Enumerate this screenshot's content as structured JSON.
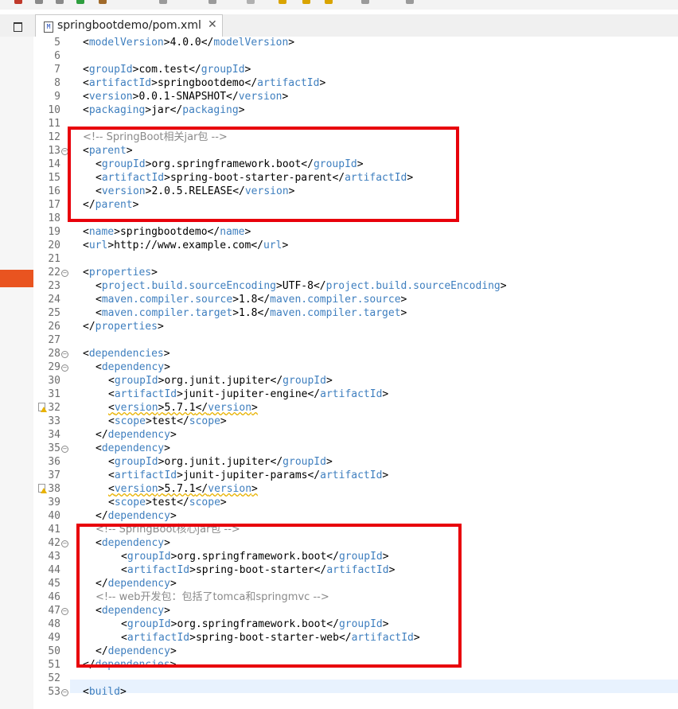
{
  "editor_tab": {
    "title": "springbootdemo/pom.xml",
    "close": "✕",
    "file_icon": "M"
  },
  "highlight_color": "#e8000b",
  "lines": [
    {
      "n": "5",
      "indent": 0,
      "tokens": [
        [
          "b",
          "<"
        ],
        [
          "t",
          "modelVersion"
        ],
        [
          "b",
          ">"
        ],
        [
          "x",
          "4.0.0"
        ],
        [
          "b",
          "</"
        ],
        [
          "t",
          "modelVersion"
        ],
        [
          "b",
          ">"
        ]
      ]
    },
    {
      "n": "6",
      "indent": 0,
      "tokens": []
    },
    {
      "n": "7",
      "indent": 0,
      "tokens": [
        [
          "b",
          "<"
        ],
        [
          "t",
          "groupId"
        ],
        [
          "b",
          ">"
        ],
        [
          "x",
          "com.test"
        ],
        [
          "b",
          "</"
        ],
        [
          "t",
          "groupId"
        ],
        [
          "b",
          ">"
        ]
      ]
    },
    {
      "n": "8",
      "indent": 0,
      "tokens": [
        [
          "b",
          "<"
        ],
        [
          "t",
          "artifactId"
        ],
        [
          "b",
          ">"
        ],
        [
          "x",
          "springbootdemo"
        ],
        [
          "b",
          "</"
        ],
        [
          "t",
          "artifactId"
        ],
        [
          "b",
          ">"
        ]
      ]
    },
    {
      "n": "9",
      "indent": 0,
      "tokens": [
        [
          "b",
          "<"
        ],
        [
          "t",
          "version"
        ],
        [
          "b",
          ">"
        ],
        [
          "x",
          "0.0.1-SNAPSHOT"
        ],
        [
          "b",
          "</"
        ],
        [
          "t",
          "version"
        ],
        [
          "b",
          ">"
        ]
      ]
    },
    {
      "n": "10",
      "indent": 0,
      "tokens": [
        [
          "b",
          "<"
        ],
        [
          "t",
          "packaging"
        ],
        [
          "b",
          ">"
        ],
        [
          "x",
          "jar"
        ],
        [
          "b",
          "</"
        ],
        [
          "t",
          "packaging"
        ],
        [
          "b",
          ">"
        ]
      ]
    },
    {
      "n": "11",
      "indent": 0,
      "tokens": []
    },
    {
      "n": "12",
      "indent": 0,
      "tokens": [
        [
          "c",
          "<!-- SpringBoot相关jar包 -->"
        ]
      ]
    },
    {
      "n": "13",
      "indent": 0,
      "fold": true,
      "tokens": [
        [
          "b",
          "<"
        ],
        [
          "t",
          "parent"
        ],
        [
          "b",
          ">"
        ]
      ]
    },
    {
      "n": "14",
      "indent": 1,
      "tokens": [
        [
          "b",
          "<"
        ],
        [
          "t",
          "groupId"
        ],
        [
          "b",
          ">"
        ],
        [
          "x",
          "org.springframework.boot"
        ],
        [
          "b",
          "</"
        ],
        [
          "t",
          "groupId"
        ],
        [
          "b",
          ">"
        ]
      ]
    },
    {
      "n": "15",
      "indent": 1,
      "tokens": [
        [
          "b",
          "<"
        ],
        [
          "t",
          "artifactId"
        ],
        [
          "b",
          ">"
        ],
        [
          "x",
          "spring-boot-starter-parent"
        ],
        [
          "b",
          "</"
        ],
        [
          "t",
          "artifactId"
        ],
        [
          "b",
          ">"
        ]
      ]
    },
    {
      "n": "16",
      "indent": 1,
      "tokens": [
        [
          "b",
          "<"
        ],
        [
          "t",
          "version"
        ],
        [
          "b",
          ">"
        ],
        [
          "x",
          "2.0.5.RELEASE"
        ],
        [
          "b",
          "</"
        ],
        [
          "t",
          "version"
        ],
        [
          "b",
          ">"
        ]
      ]
    },
    {
      "n": "17",
      "indent": 0,
      "tokens": [
        [
          "b",
          "</"
        ],
        [
          "t",
          "parent"
        ],
        [
          "b",
          ">"
        ]
      ]
    },
    {
      "n": "18",
      "indent": 0,
      "tokens": []
    },
    {
      "n": "19",
      "indent": 0,
      "tokens": [
        [
          "b",
          "<"
        ],
        [
          "t",
          "name"
        ],
        [
          "b",
          ">"
        ],
        [
          "x",
          "springbootdemo"
        ],
        [
          "b",
          "</"
        ],
        [
          "t",
          "name"
        ],
        [
          "b",
          ">"
        ]
      ]
    },
    {
      "n": "20",
      "indent": 0,
      "tokens": [
        [
          "b",
          "<"
        ],
        [
          "t",
          "url"
        ],
        [
          "b",
          ">"
        ],
        [
          "x",
          "http://www.example.com"
        ],
        [
          "b",
          "</"
        ],
        [
          "t",
          "url"
        ],
        [
          "b",
          ">"
        ]
      ]
    },
    {
      "n": "21",
      "indent": 0,
      "tokens": []
    },
    {
      "n": "22",
      "indent": 0,
      "fold": true,
      "tokens": [
        [
          "b",
          "<"
        ],
        [
          "t",
          "properties"
        ],
        [
          "b",
          ">"
        ]
      ]
    },
    {
      "n": "23",
      "indent": 1,
      "tokens": [
        [
          "b",
          "<"
        ],
        [
          "t",
          "project.build.sourceEncoding"
        ],
        [
          "b",
          ">"
        ],
        [
          "x",
          "UTF-8"
        ],
        [
          "b",
          "</"
        ],
        [
          "t",
          "project.build.sourceEncoding"
        ],
        [
          "b",
          ">"
        ]
      ]
    },
    {
      "n": "24",
      "indent": 1,
      "tokens": [
        [
          "b",
          "<"
        ],
        [
          "t",
          "maven.compiler.source"
        ],
        [
          "b",
          ">"
        ],
        [
          "x",
          "1.8"
        ],
        [
          "b",
          "</"
        ],
        [
          "t",
          "maven.compiler.source"
        ],
        [
          "b",
          ">"
        ]
      ]
    },
    {
      "n": "25",
      "indent": 1,
      "tokens": [
        [
          "b",
          "<"
        ],
        [
          "t",
          "maven.compiler.target"
        ],
        [
          "b",
          ">"
        ],
        [
          "x",
          "1.8"
        ],
        [
          "b",
          "</"
        ],
        [
          "t",
          "maven.compiler.target"
        ],
        [
          "b",
          ">"
        ]
      ]
    },
    {
      "n": "26",
      "indent": 0,
      "tokens": [
        [
          "b",
          "</"
        ],
        [
          "t",
          "properties"
        ],
        [
          "b",
          ">"
        ]
      ]
    },
    {
      "n": "27",
      "indent": 0,
      "tokens": []
    },
    {
      "n": "28",
      "indent": 0,
      "fold": true,
      "tokens": [
        [
          "b",
          "<"
        ],
        [
          "t",
          "dependencies"
        ],
        [
          "b",
          ">"
        ]
      ]
    },
    {
      "n": "29",
      "indent": 1,
      "fold": true,
      "tokens": [
        [
          "b",
          "<"
        ],
        [
          "t",
          "dependency"
        ],
        [
          "b",
          ">"
        ]
      ]
    },
    {
      "n": "30",
      "indent": 2,
      "tokens": [
        [
          "b",
          "<"
        ],
        [
          "t",
          "groupId"
        ],
        [
          "b",
          ">"
        ],
        [
          "x",
          "org.junit.jupiter"
        ],
        [
          "b",
          "</"
        ],
        [
          "t",
          "groupId"
        ],
        [
          "b",
          ">"
        ]
      ]
    },
    {
      "n": "31",
      "indent": 2,
      "tokens": [
        [
          "b",
          "<"
        ],
        [
          "t",
          "artifactId"
        ],
        [
          "b",
          ">"
        ],
        [
          "x",
          "junit-jupiter-engine"
        ],
        [
          "b",
          "</"
        ],
        [
          "t",
          "artifactId"
        ],
        [
          "b",
          ">"
        ]
      ]
    },
    {
      "n": "32",
      "indent": 2,
      "warn": true,
      "squig": true,
      "tokens": [
        [
          "b",
          "<"
        ],
        [
          "t",
          "version"
        ],
        [
          "b",
          ">"
        ],
        [
          "x",
          "5.7.1"
        ],
        [
          "b",
          "</"
        ],
        [
          "t",
          "version"
        ],
        [
          "b",
          ">"
        ]
      ]
    },
    {
      "n": "33",
      "indent": 2,
      "tokens": [
        [
          "b",
          "<"
        ],
        [
          "t",
          "scope"
        ],
        [
          "b",
          ">"
        ],
        [
          "x",
          "test"
        ],
        [
          "b",
          "</"
        ],
        [
          "t",
          "scope"
        ],
        [
          "b",
          ">"
        ]
      ]
    },
    {
      "n": "34",
      "indent": 1,
      "tokens": [
        [
          "b",
          "</"
        ],
        [
          "t",
          "dependency"
        ],
        [
          "b",
          ">"
        ]
      ]
    },
    {
      "n": "35",
      "indent": 1,
      "fold": true,
      "tokens": [
        [
          "b",
          "<"
        ],
        [
          "t",
          "dependency"
        ],
        [
          "b",
          ">"
        ]
      ]
    },
    {
      "n": "36",
      "indent": 2,
      "tokens": [
        [
          "b",
          "<"
        ],
        [
          "t",
          "groupId"
        ],
        [
          "b",
          ">"
        ],
        [
          "x",
          "org.junit.jupiter"
        ],
        [
          "b",
          "</"
        ],
        [
          "t",
          "groupId"
        ],
        [
          "b",
          ">"
        ]
      ]
    },
    {
      "n": "37",
      "indent": 2,
      "tokens": [
        [
          "b",
          "<"
        ],
        [
          "t",
          "artifactId"
        ],
        [
          "b",
          ">"
        ],
        [
          "x",
          "junit-jupiter-params"
        ],
        [
          "b",
          "</"
        ],
        [
          "t",
          "artifactId"
        ],
        [
          "b",
          ">"
        ]
      ]
    },
    {
      "n": "38",
      "indent": 2,
      "warn": true,
      "squig": true,
      "tokens": [
        [
          "b",
          "<"
        ],
        [
          "t",
          "version"
        ],
        [
          "b",
          ">"
        ],
        [
          "x",
          "5.7.1"
        ],
        [
          "b",
          "</"
        ],
        [
          "t",
          "version"
        ],
        [
          "b",
          ">"
        ]
      ]
    },
    {
      "n": "39",
      "indent": 2,
      "tokens": [
        [
          "b",
          "<"
        ],
        [
          "t",
          "scope"
        ],
        [
          "b",
          ">"
        ],
        [
          "x",
          "test"
        ],
        [
          "b",
          "</"
        ],
        [
          "t",
          "scope"
        ],
        [
          "b",
          ">"
        ]
      ]
    },
    {
      "n": "40",
      "indent": 1,
      "tokens": [
        [
          "b",
          "</"
        ],
        [
          "t",
          "dependency"
        ],
        [
          "b",
          ">"
        ]
      ]
    },
    {
      "n": "41",
      "indent": 1,
      "tokens": [
        [
          "c",
          "<!-- SpringBoot核心jar包 -->"
        ]
      ]
    },
    {
      "n": "42",
      "indent": 1,
      "fold": true,
      "tokens": [
        [
          "b",
          "<"
        ],
        [
          "t",
          "dependency"
        ],
        [
          "b",
          ">"
        ]
      ]
    },
    {
      "n": "43",
      "indent": 3,
      "tokens": [
        [
          "b",
          "<"
        ],
        [
          "t",
          "groupId"
        ],
        [
          "b",
          ">"
        ],
        [
          "x",
          "org.springframework.boot"
        ],
        [
          "b",
          "</"
        ],
        [
          "t",
          "groupId"
        ],
        [
          "b",
          ">"
        ]
      ]
    },
    {
      "n": "44",
      "indent": 3,
      "tokens": [
        [
          "b",
          "<"
        ],
        [
          "t",
          "artifactId"
        ],
        [
          "b",
          ">"
        ],
        [
          "x",
          "spring-boot-starter"
        ],
        [
          "b",
          "</"
        ],
        [
          "t",
          "artifactId"
        ],
        [
          "b",
          ">"
        ]
      ]
    },
    {
      "n": "45",
      "indent": 1,
      "tokens": [
        [
          "b",
          "</"
        ],
        [
          "t",
          "dependency"
        ],
        [
          "b",
          ">"
        ]
      ]
    },
    {
      "n": "46",
      "indent": 1,
      "tokens": [
        [
          "c",
          "<!-- web开发包：包括了tomca和springmvc -->"
        ]
      ]
    },
    {
      "n": "47",
      "indent": 1,
      "fold": true,
      "tokens": [
        [
          "b",
          "<"
        ],
        [
          "t",
          "dependency"
        ],
        [
          "b",
          ">"
        ]
      ]
    },
    {
      "n": "48",
      "indent": 3,
      "tokens": [
        [
          "b",
          "<"
        ],
        [
          "t",
          "groupId"
        ],
        [
          "b",
          ">"
        ],
        [
          "x",
          "org.springframework.boot"
        ],
        [
          "b",
          "</"
        ],
        [
          "t",
          "groupId"
        ],
        [
          "b",
          ">"
        ]
      ]
    },
    {
      "n": "49",
      "indent": 3,
      "tokens": [
        [
          "b",
          "<"
        ],
        [
          "t",
          "artifactId"
        ],
        [
          "b",
          ">"
        ],
        [
          "x",
          "spring-boot-starter-web"
        ],
        [
          "b",
          "</"
        ],
        [
          "t",
          "artifactId"
        ],
        [
          "b",
          ">"
        ]
      ]
    },
    {
      "n": "50",
      "indent": 1,
      "tokens": [
        [
          "b",
          "</"
        ],
        [
          "t",
          "dependency"
        ],
        [
          "b",
          ">"
        ]
      ]
    },
    {
      "n": "51",
      "indent": 0,
      "tokens": [
        [
          "b",
          "</"
        ],
        [
          "t",
          "dependencies"
        ],
        [
          "b",
          ">"
        ]
      ]
    },
    {
      "n": "52",
      "indent": 0,
      "tokens": []
    },
    {
      "n": "53",
      "indent": 0,
      "fold": true,
      "tokens": [
        [
          "b",
          "<"
        ],
        [
          "t",
          "build"
        ],
        [
          "b",
          ">"
        ]
      ]
    }
  ]
}
